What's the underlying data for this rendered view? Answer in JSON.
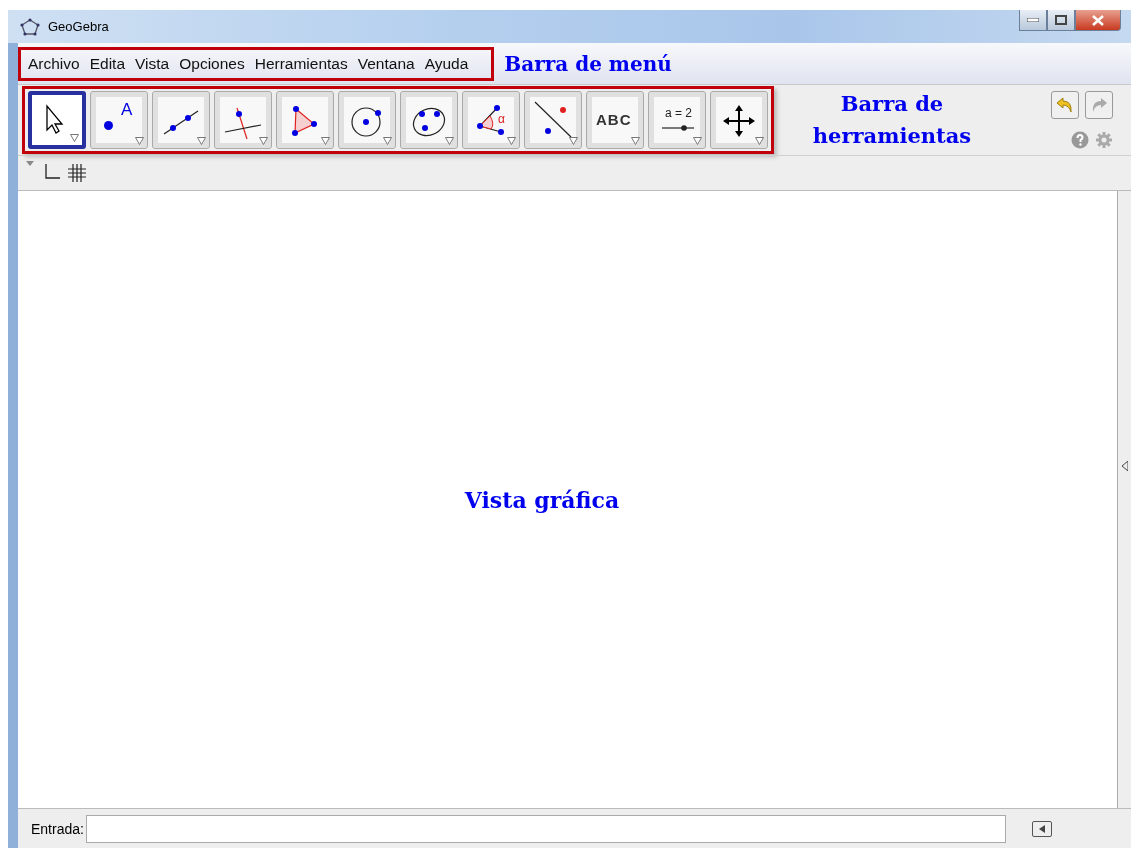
{
  "window": {
    "title": "GeoGebra"
  },
  "menu": [
    {
      "label": "Archivo"
    },
    {
      "label": "Edita"
    },
    {
      "label": "Vista"
    },
    {
      "label": "Opciones"
    },
    {
      "label": "Herramientas"
    },
    {
      "label": "Ventana"
    },
    {
      "label": "Ayuda"
    }
  ],
  "annotations": {
    "menu_bar": "Barra de menú",
    "toolbar": "Barra de herramientas",
    "graphics_view": "Vista gráfica"
  },
  "tools": [
    {
      "kind": "move",
      "selected": true
    },
    {
      "kind": "point",
      "selected": false,
      "label": "A"
    },
    {
      "kind": "line",
      "selected": false
    },
    {
      "kind": "perpendicular",
      "selected": false
    },
    {
      "kind": "polygon",
      "selected": false
    },
    {
      "kind": "circle",
      "selected": false
    },
    {
      "kind": "conic",
      "selected": false
    },
    {
      "kind": "angle",
      "selected": false,
      "label": "α"
    },
    {
      "kind": "reflect",
      "selected": false
    },
    {
      "kind": "text",
      "selected": false,
      "label": "ABC"
    },
    {
      "kind": "slider",
      "selected": false,
      "label": "a = 2"
    },
    {
      "kind": "move-view",
      "selected": false
    }
  ],
  "input_bar": {
    "label": "Entrada:"
  }
}
